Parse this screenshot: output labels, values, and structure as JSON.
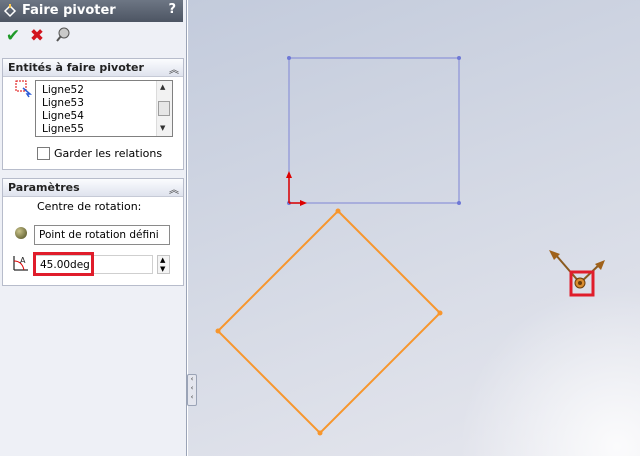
{
  "property_manager": {
    "title": "Faire pivoter",
    "help": "?",
    "ok": "✔",
    "cancel": "✖",
    "pushpin": "pushpin-icon"
  },
  "entities_group": {
    "title": "Entités à faire pivoter",
    "items": [
      "Ligne52",
      "Ligne53",
      "Ligne54",
      "Ligne55"
    ],
    "keep_relations_label": "Garder les relations"
  },
  "parameters_group": {
    "title": "Paramètres",
    "center_label": "Centre de rotation:",
    "center_value": "Point de rotation défini",
    "angle_value": "45.00deg"
  },
  "colors": {
    "original_sketch": "#8c93d8",
    "rotated_sketch": "#f7962d",
    "highlight": "#e01d2b"
  }
}
